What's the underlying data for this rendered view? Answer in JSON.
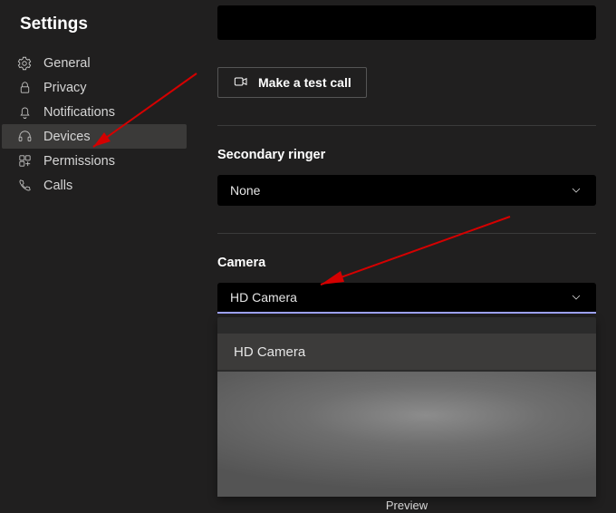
{
  "title": "Settings",
  "sidebar": {
    "items": [
      {
        "label": "General"
      },
      {
        "label": "Privacy"
      },
      {
        "label": "Notifications"
      },
      {
        "label": "Devices"
      },
      {
        "label": "Permissions"
      },
      {
        "label": "Calls"
      }
    ]
  },
  "main": {
    "test_call_label": "Make a test call",
    "secondary_ringer_title": "Secondary ringer",
    "secondary_ringer_value": "None",
    "camera_title": "Camera",
    "camera_value": "HD Camera",
    "camera_options": [
      {
        "label": "HD Camera"
      }
    ],
    "preview_label": "Preview"
  },
  "colors": {
    "accent": "#9ea2ff",
    "annotation": "#d40000"
  }
}
